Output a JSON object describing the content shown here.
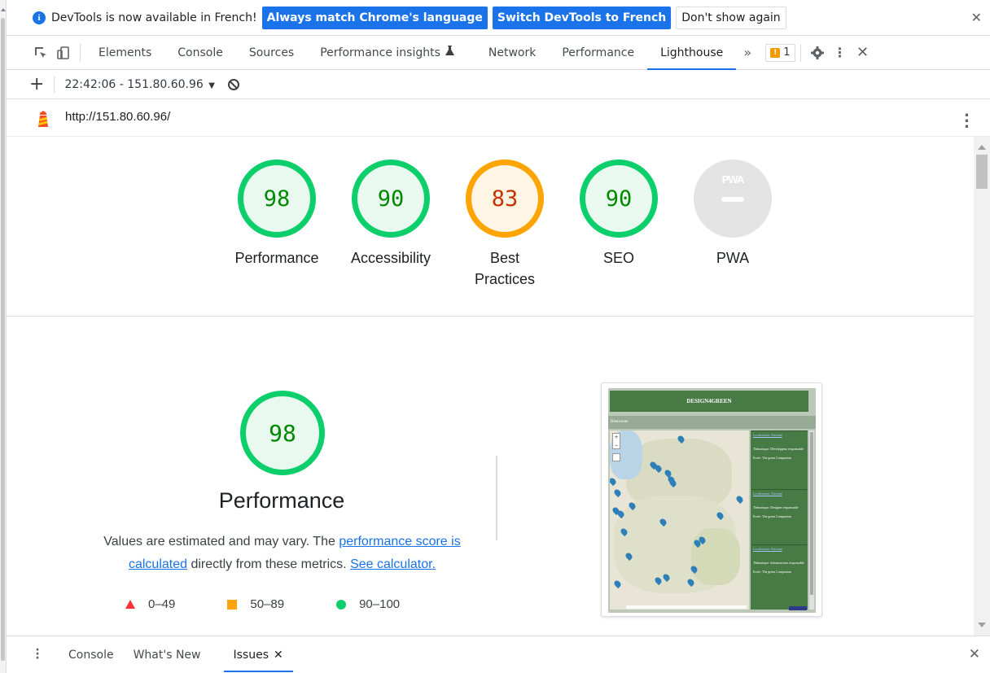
{
  "infobar": {
    "message": "DevTools is now available in French!",
    "btn_match": "Always match Chrome's language",
    "btn_switch": "Switch DevTools to French",
    "btn_dismiss": "Don't show again"
  },
  "toolbar": {
    "tabs": [
      "Elements",
      "Console",
      "Sources",
      "Performance insights",
      "Network",
      "Performance",
      "Lighthouse"
    ],
    "active_tab": "Lighthouse",
    "issues_count": "1"
  },
  "subbar": {
    "report": "22:42:06 - 151.80.60.96"
  },
  "urlbar": {
    "url": "http://151.80.60.96/"
  },
  "scores": [
    {
      "label": "Performance",
      "value": "98",
      "rating": "pass"
    },
    {
      "label": "Accessibility",
      "value": "90",
      "rating": "pass"
    },
    {
      "label": "Best Practices",
      "value": "83",
      "rating": "average"
    },
    {
      "label": "SEO",
      "value": "90",
      "rating": "pass"
    },
    {
      "label": "PWA",
      "value": "",
      "rating": "na",
      "badge": "PWA"
    }
  ],
  "performance": {
    "score": "98",
    "title": "Performance",
    "desc_prefix": "Values are estimated and may vary. The ",
    "link_score": "performance score is calculated",
    "desc_mid": " directly from these metrics. ",
    "link_calc": "See calculator.",
    "legend": [
      "0–49",
      "50–89",
      "90–100"
    ]
  },
  "screenshot": {
    "site_title": "DESIGN4GREEN",
    "nav": "Bienvenue",
    "cards": [
      {
        "link": "Localisation: National",
        "theme": "Thématique: Développeur responsable",
        "school": "Ecole: The green Companion"
      },
      {
        "link": "Localisation: National",
        "theme": "Thématique: Designer responsable",
        "school": "Ecole: The green Companion"
      },
      {
        "link": "Localisation: National",
        "theme": "Thématique: Infrastructure responsable",
        "school": "Ecole: The green Companion"
      }
    ]
  },
  "drawer": {
    "tabs": [
      "Console",
      "What's New",
      "Issues"
    ],
    "active_tab": "Issues"
  },
  "colors": {
    "pass": "#0cce6b",
    "average": "#ffa400",
    "fail": "#ff3333",
    "accent": "#1a73e8"
  }
}
